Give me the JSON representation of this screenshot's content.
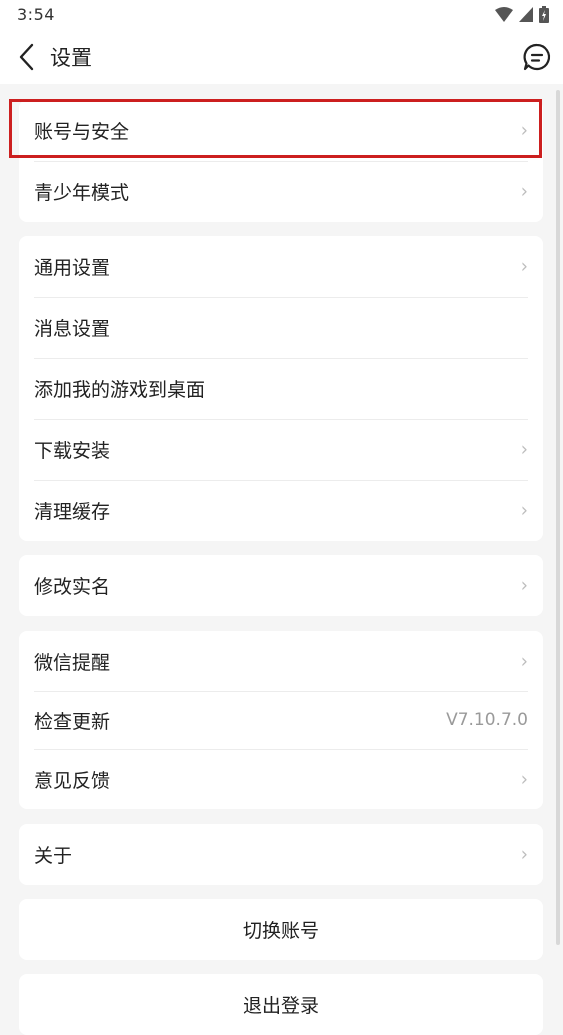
{
  "status": {
    "time": "3:54"
  },
  "header": {
    "title": "设置"
  },
  "groups": [
    {
      "items": [
        {
          "label": "账号与安全",
          "chevron": true
        },
        {
          "label": "青少年模式",
          "chevron": true
        }
      ]
    },
    {
      "items": [
        {
          "label": "通用设置",
          "chevron": true
        },
        {
          "label": "消息设置",
          "chevron": false
        },
        {
          "label": "添加我的游戏到桌面",
          "chevron": false
        },
        {
          "label": "下载安装",
          "chevron": true
        },
        {
          "label": "清理缓存",
          "chevron": true
        }
      ]
    },
    {
      "items": [
        {
          "label": "修改实名",
          "chevron": true
        }
      ]
    },
    {
      "items": [
        {
          "label": "微信提醒",
          "chevron": true
        },
        {
          "label": "检查更新",
          "value": "V7.10.7.0"
        },
        {
          "label": "意见反馈",
          "chevron": true
        }
      ]
    },
    {
      "items": [
        {
          "label": "关于",
          "chevron": true
        }
      ]
    }
  ],
  "actions": {
    "switch_account": "切换账号",
    "logout": "退出登录"
  },
  "chevron_glyph": "›",
  "colors": {
    "highlight": "#cc1f1f",
    "background": "#f5f5f5"
  }
}
